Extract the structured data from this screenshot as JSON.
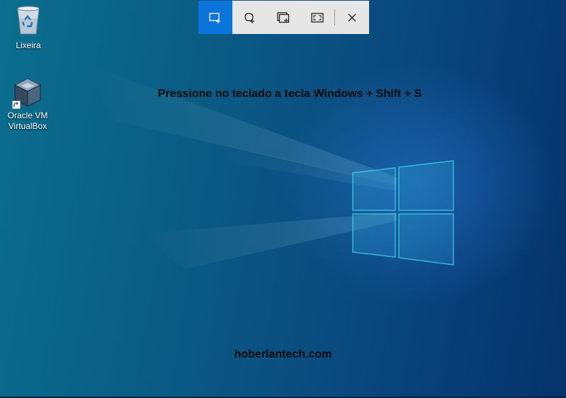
{
  "desktop": {
    "icons": [
      {
        "label": "Lixeira",
        "icon": "recycle-bin-icon"
      },
      {
        "label": "Oracle VM\nVirtualBox",
        "icon": "virtualbox-icon"
      }
    ],
    "background_colors": {
      "left": "#0b6f8f",
      "right": "#06336a",
      "logo_glow": "#3fd0e8"
    }
  },
  "snip_toolbar": {
    "tools": [
      {
        "name": "Rectangular snip",
        "icon": "rectangle-snip-icon",
        "active": true
      },
      {
        "name": "Freeform snip",
        "icon": "freeform-snip-icon",
        "active": false
      },
      {
        "name": "Window snip",
        "icon": "window-snip-icon",
        "active": false
      },
      {
        "name": "Fullscreen snip",
        "icon": "fullscreen-snip-icon",
        "active": false
      },
      {
        "name": "Close",
        "icon": "close-icon",
        "active": false
      }
    ],
    "accent_color": "#0a74da",
    "background_color": "#e6e6e6"
  },
  "overlay": {
    "instruction": "Pressione no teclado a tecla Windows + Shift + S",
    "watermark": "hoberlantech.com"
  }
}
